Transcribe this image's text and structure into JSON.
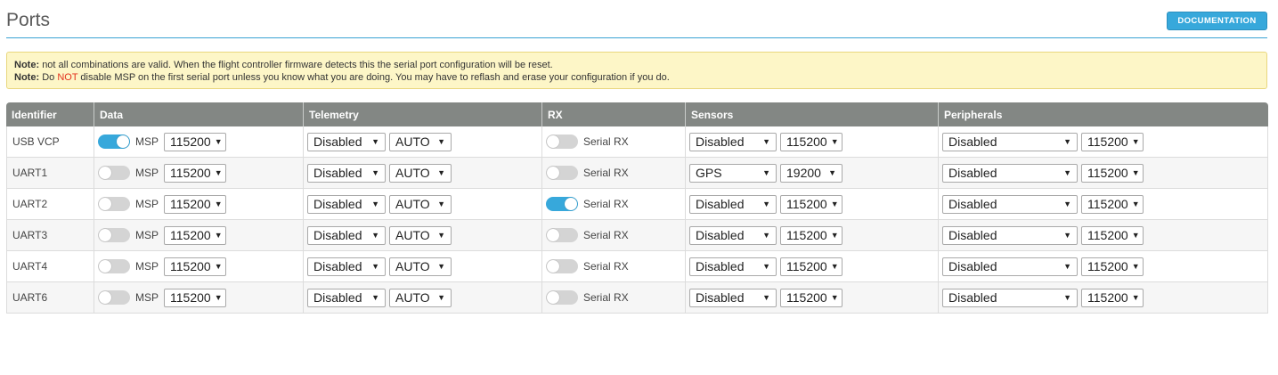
{
  "header": {
    "title": "Ports",
    "doc_button": "DOCUMENTATION"
  },
  "note": {
    "label": "Note",
    "line1": "not all combinations are valid. When the flight controller firmware detects this the serial port configuration will be reset.",
    "line2_pre": "Do ",
    "line2_not": "NOT",
    "line2_post": " disable MSP on the first serial port unless you know what you are doing. You may have to reflash and erase your configuration if you do."
  },
  "columns": [
    "Identifier",
    "Data",
    "Telemetry",
    "RX",
    "Sensors",
    "Peripherals"
  ],
  "labels": {
    "msp": "MSP",
    "serial_rx": "Serial RX"
  },
  "rows": [
    {
      "id": "USB VCP",
      "msp_on": true,
      "data_baud": "115200",
      "telemetry": "Disabled",
      "telemetry_baud": "AUTO",
      "rx_on": false,
      "sensors": "Disabled",
      "sensors_baud": "115200",
      "peripherals": "Disabled",
      "peripherals_baud": "115200"
    },
    {
      "id": "UART1",
      "msp_on": false,
      "data_baud": "115200",
      "telemetry": "Disabled",
      "telemetry_baud": "AUTO",
      "rx_on": false,
      "sensors": "GPS",
      "sensors_baud": "19200",
      "peripherals": "Disabled",
      "peripherals_baud": "115200"
    },
    {
      "id": "UART2",
      "msp_on": false,
      "data_baud": "115200",
      "telemetry": "Disabled",
      "telemetry_baud": "AUTO",
      "rx_on": true,
      "sensors": "Disabled",
      "sensors_baud": "115200",
      "peripherals": "Disabled",
      "peripherals_baud": "115200"
    },
    {
      "id": "UART3",
      "msp_on": false,
      "data_baud": "115200",
      "telemetry": "Disabled",
      "telemetry_baud": "AUTO",
      "rx_on": false,
      "sensors": "Disabled",
      "sensors_baud": "115200",
      "peripherals": "Disabled",
      "peripherals_baud": "115200"
    },
    {
      "id": "UART4",
      "msp_on": false,
      "data_baud": "115200",
      "telemetry": "Disabled",
      "telemetry_baud": "AUTO",
      "rx_on": false,
      "sensors": "Disabled",
      "sensors_baud": "115200",
      "peripherals": "Disabled",
      "peripherals_baud": "115200"
    },
    {
      "id": "UART6",
      "msp_on": false,
      "data_baud": "115200",
      "telemetry": "Disabled",
      "telemetry_baud": "AUTO",
      "rx_on": false,
      "sensors": "Disabled",
      "sensors_baud": "115200",
      "peripherals": "Disabled",
      "peripherals_baud": "115200"
    }
  ],
  "colors": {
    "accent": "#37a8db",
    "header_bg": "#838784",
    "note_bg": "#fdf6c7",
    "warn": "#e3321e"
  }
}
